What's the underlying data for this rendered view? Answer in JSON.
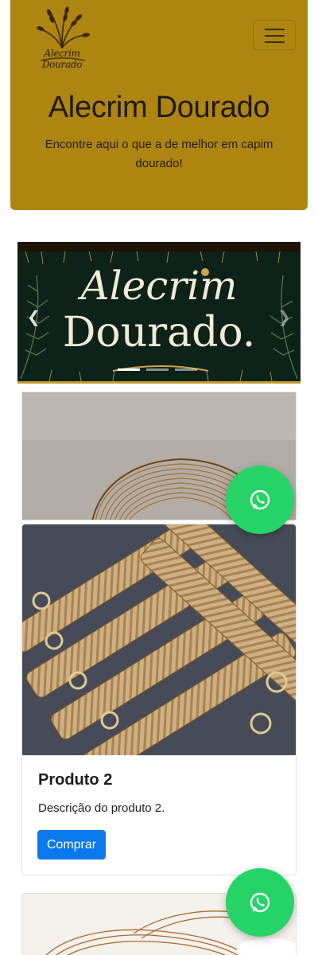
{
  "header": {
    "logo_text": "Alecrim Dourado",
    "menu_icon": "hamburger-icon",
    "title": "Alecrim Dourado",
    "subtitle": "Encontre aqui o que a de melhor em capim dourado!"
  },
  "carousel": {
    "banner_line1": "Alecrim",
    "banner_line2": "Dourado.",
    "prev_icon": "chevron-left-icon",
    "next_icon": "chevron-right-icon",
    "slide_count": 3,
    "active_slide": 1
  },
  "products": [
    {
      "title": "Produto 2",
      "description": "Descrição do produto 2.",
      "button_label": "Comprar"
    }
  ],
  "whatsapp": {
    "icon": "whatsapp-icon"
  },
  "colors": {
    "hero_bg": "#ae8512",
    "primary": "#0b78ee",
    "whatsapp": "#25d366",
    "banner_bg": "#0d2219"
  }
}
